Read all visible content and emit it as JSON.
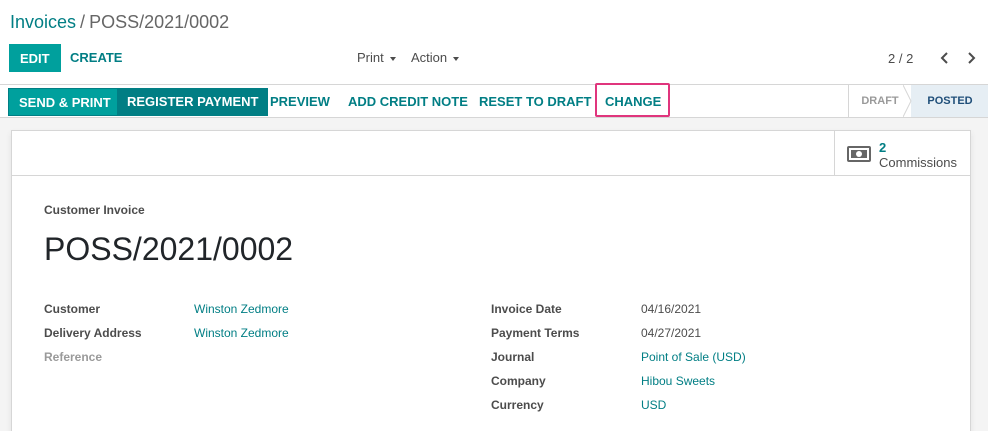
{
  "breadcrumb": {
    "parent": "Invoices",
    "separator": "/",
    "current": "POSS/2021/0002"
  },
  "control_panel": {
    "edit_label": "EDIT",
    "create_label": "CREATE",
    "print_label": "Print",
    "action_label": "Action",
    "pager_value": "2 / 2"
  },
  "status_bar": {
    "buttons": [
      "SEND & PRINT",
      "REGISTER PAYMENT",
      "PREVIEW",
      "ADD CREDIT NOTE",
      "RESET TO DRAFT",
      "CHANGE"
    ],
    "highlighted_button": "CHANGE",
    "stages": [
      "DRAFT",
      "POSTED"
    ],
    "active_stage": "POSTED"
  },
  "smart_button": {
    "count": "2",
    "label": "Commissions",
    "icon": "money-icon"
  },
  "invoice": {
    "type_label": "Customer Invoice",
    "name": "POSS/2021/0002",
    "left_fields": [
      {
        "label": "Customer",
        "value": "Winston Zedmore"
      },
      {
        "label": "Delivery Address",
        "value": "Winston Zedmore"
      },
      {
        "label": "Reference",
        "value": ""
      }
    ],
    "right_fields": [
      {
        "label": "Invoice Date",
        "value": "04/16/2021"
      },
      {
        "label": "Payment Terms",
        "value": "04/27/2021"
      },
      {
        "label": "Journal",
        "value": "Point of Sale (USD)"
      },
      {
        "label": "Company",
        "value": "Hibou Sweets"
      },
      {
        "label": "Currency",
        "value": "USD"
      }
    ]
  },
  "colors": {
    "primary": "#00a09d",
    "link": "#017e84",
    "highlight": "#e0357d",
    "active_stage": "#1f4e79"
  },
  "icons": {
    "print_caret": "caret-down-icon",
    "action_caret": "caret-down-icon",
    "pager_prev": "chevron-left-icon",
    "pager_next": "chevron-right-icon"
  }
}
